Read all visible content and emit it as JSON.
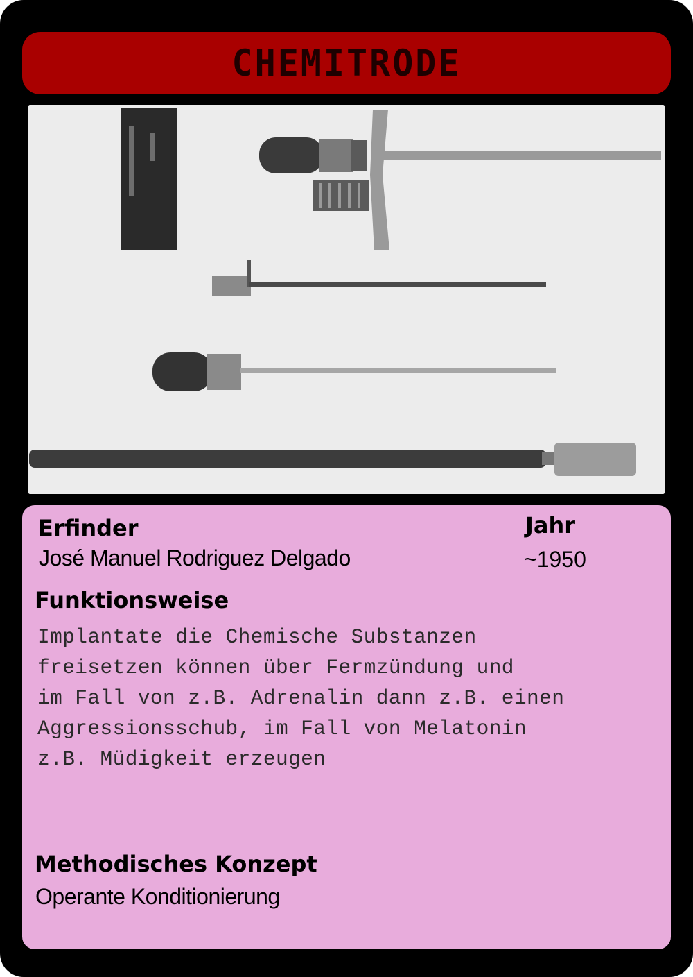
{
  "title": "CHEMITRODE",
  "photo": {
    "icon": "chemitrode-implant-photo"
  },
  "inventor": {
    "label": "Erfinder",
    "value": "José Manuel Rodriguez Delgado"
  },
  "year": {
    "label": "Jahr",
    "value": "~1950"
  },
  "function": {
    "label": "Funktionsweise",
    "lines": [
      "Implantate die Chemische Substanzen",
      "freisetzen können über Fermzündung und",
      "im Fall von z.B. Adrenalin dann z.B. einen",
      "Aggressionsschub, im Fall von Melatonin",
      "z.B. Müdigkeit erzeugen"
    ]
  },
  "concept": {
    "label": "Methodisches Konzept",
    "value": "Operante Konditionierung"
  },
  "colors": {
    "card_border": "#000000",
    "title_bar": "#a90000",
    "info_panel": "#e8acdc"
  }
}
